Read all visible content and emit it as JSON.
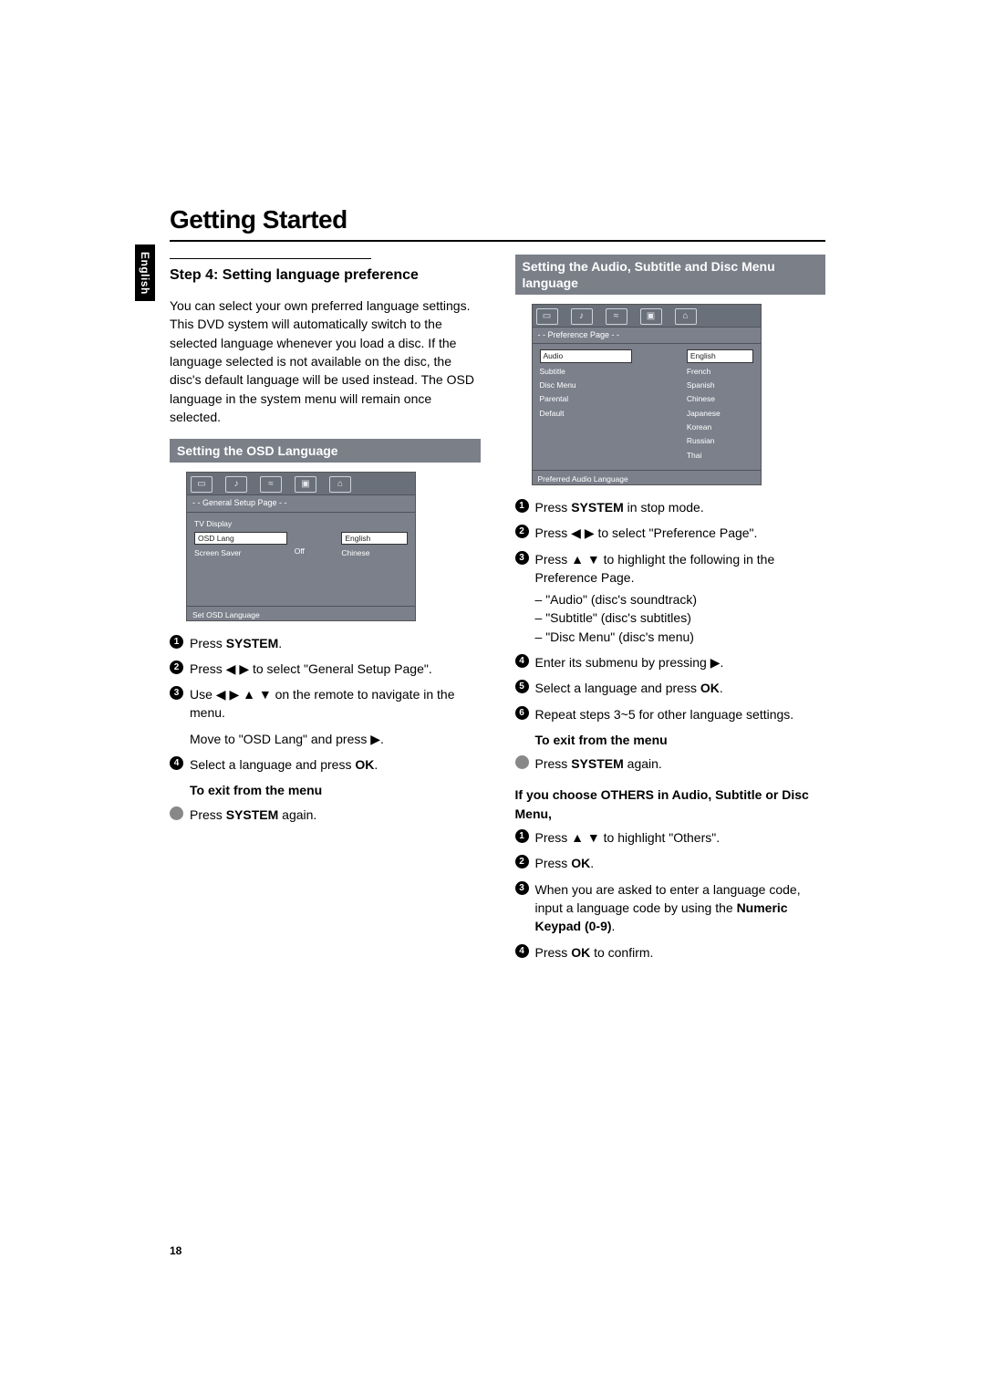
{
  "language_tab": "English",
  "title": "Getting Started",
  "page_number": "18",
  "left": {
    "step_heading": "Step 4:  Setting language preference",
    "intro": "You can select your own preferred language settings. This DVD system will automatically switch to the selected language whenever you load a disc. If the language selected is not available on the disc, the disc's default language will be used instead. The OSD language in the system menu will remain once selected.",
    "section_bar": "Setting the OSD Language",
    "osd": {
      "banner": "- - General Setup Page - -",
      "menu": {
        "tv_display": "TV Display",
        "osd_lang": "OSD Lang",
        "screen_saver": "Screen Saver",
        "off": "Off"
      },
      "right": {
        "english": "English",
        "chinese": "Chinese"
      },
      "footer": "Set OSD Language"
    },
    "steps": {
      "s1_a": "Press ",
      "s1_b": "SYSTEM",
      "s1_c": ".",
      "s2": "Press ◀ ▶ to select \"General Setup Page\".",
      "s3a": "Use ◀ ▶ ▲ ▼ on the remote to navigate in the menu.",
      "s3b": "Move to \"OSD Lang\" and press ▶.",
      "s4_a": "Select a language and press ",
      "s4_b": "OK",
      "s4_c": "."
    },
    "exit_heading": "To exit from the menu",
    "exit_a": "Press ",
    "exit_b": "SYSTEM",
    "exit_c": " again."
  },
  "right": {
    "section_bar": "Setting the Audio, Subtitle and Disc Menu language",
    "osd": {
      "banner": "- - Preference Page - -",
      "menu": {
        "audio": "Audio",
        "subtitle": "Subtitle",
        "disc_menu": "Disc Menu",
        "parental": "Parental",
        "default": "Default"
      },
      "right": {
        "english": "English",
        "french": "French",
        "spanish": "Spanish",
        "chinese": "Chinese",
        "japanese": "Japanese",
        "korean": "Korean",
        "russian": "Russian",
        "thai": "Thai"
      },
      "footer": "Preferred Audio Language"
    },
    "steps": {
      "s1_a": "Press ",
      "s1_b": "SYSTEM",
      "s1_c": " in stop mode.",
      "s2": "Press ◀ ▶ to select \"Preference Page\".",
      "s3a": "Press ▲ ▼ to highlight the following in the Preference Page.",
      "s3_sub1": "\"Audio\" (disc's soundtrack)",
      "s3_sub2": "\"Subtitle\" (disc's subtitles)",
      "s3_sub3": "\"Disc Menu\" (disc's menu)",
      "s4": "Enter its submenu by pressing ▶.",
      "s5_a": "Select a language and press ",
      "s5_b": "OK",
      "s5_c": ".",
      "s6": "Repeat steps 3~5 for other language settings."
    },
    "exit_heading": "To exit from the menu",
    "exit_a": "Press ",
    "exit_b": "SYSTEM",
    "exit_c": " again.",
    "others_heading": "If you choose OTHERS in Audio, Subtitle or Disc Menu,",
    "others": {
      "o1": "Press ▲ ▼ to highlight \"Others\".",
      "o2_a": "Press ",
      "o2_b": "OK",
      "o2_c": ".",
      "o3_a": "When you are asked to enter a language code, input a language code by using the ",
      "o3_b": "Numeric Keypad (0-9)",
      "o3_c": ".",
      "o4_a": "Press ",
      "o4_b": "OK",
      "o4_c": " to confirm."
    }
  }
}
